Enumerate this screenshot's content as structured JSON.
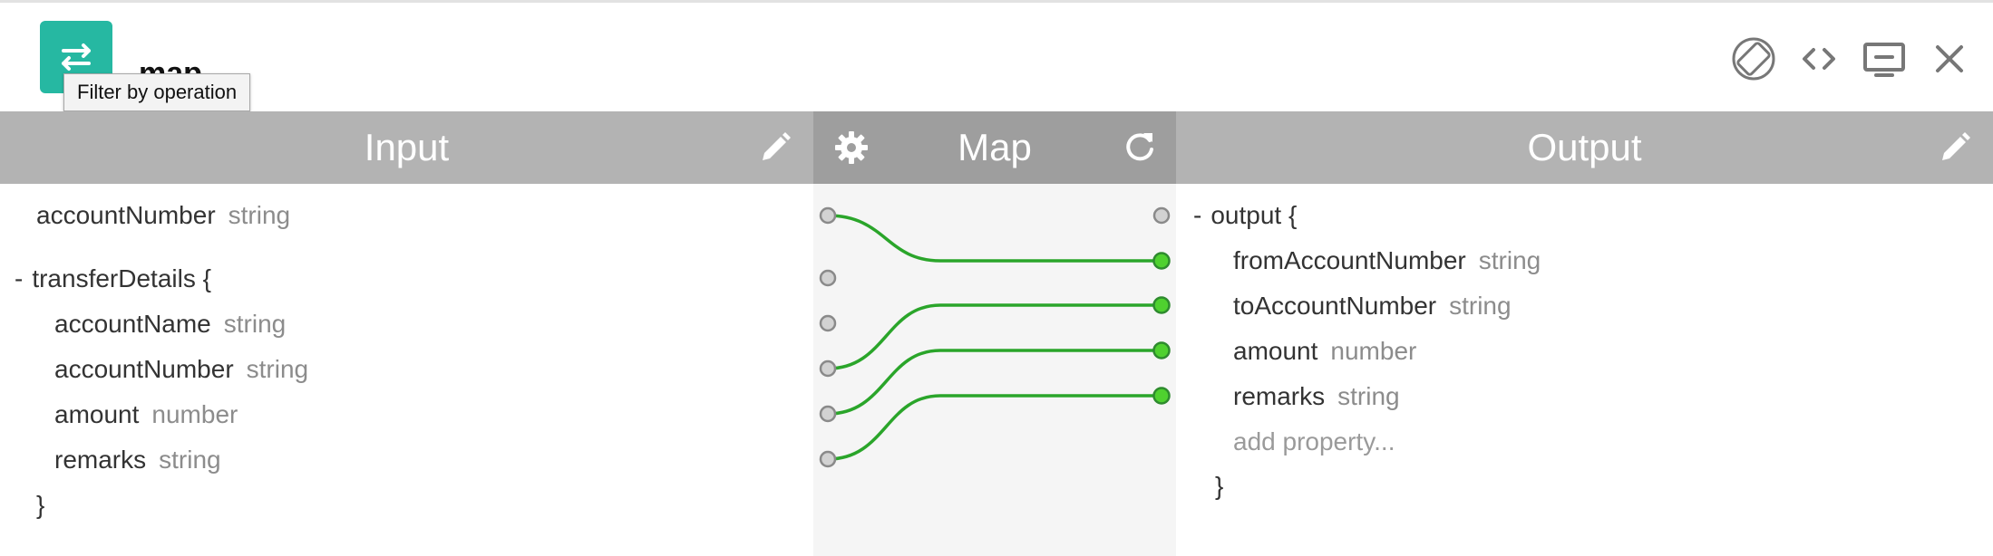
{
  "header": {
    "title": "map",
    "tooltip": "Filter by operation",
    "operation_icon": "swap-arrows-icon",
    "actions": [
      {
        "name": "rotate-screen-icon"
      },
      {
        "name": "code-icon"
      },
      {
        "name": "monitor-icon"
      },
      {
        "name": "close-icon"
      }
    ]
  },
  "panes": {
    "input": {
      "title": "Input",
      "action_icon": "pencil-icon"
    },
    "map": {
      "title": "Map",
      "left_icon": "gear-icon",
      "right_icon": "refresh-icon"
    },
    "output": {
      "title": "Output",
      "action_icon": "pencil-icon"
    }
  },
  "input": {
    "accountNumber": {
      "name": "accountNumber",
      "type": "string"
    },
    "transferDetails": {
      "collapse": "-",
      "name": "transferDetails {",
      "fields": [
        {
          "name": "accountName",
          "type": "string"
        },
        {
          "name": "accountNumber",
          "type": "string"
        },
        {
          "name": "amount",
          "type": "number"
        },
        {
          "name": "remarks",
          "type": "string"
        }
      ],
      "close": "}"
    }
  },
  "output": {
    "collapse": "-",
    "name": "output {",
    "fields": [
      {
        "name": "fromAccountNumber",
        "type": "string"
      },
      {
        "name": "toAccountNumber",
        "type": "string"
      },
      {
        "name": "amount",
        "type": "number"
      },
      {
        "name": "remarks",
        "type": "string"
      }
    ],
    "add_property": "add property...",
    "close": "}"
  },
  "mappings": [
    {
      "from": "accountNumber",
      "to": "fromAccountNumber"
    },
    {
      "from": "transferDetails.accountNumber",
      "to": "toAccountNumber"
    },
    {
      "from": "transferDetails.amount",
      "to": "amount"
    },
    {
      "from": "transferDetails.remarks",
      "to": "remarks"
    }
  ],
  "colors": {
    "accent": "#26b8a2",
    "connection": "#2aa52a",
    "connected_port": "#4fd12f",
    "idle_port": "#b5b5b5"
  }
}
